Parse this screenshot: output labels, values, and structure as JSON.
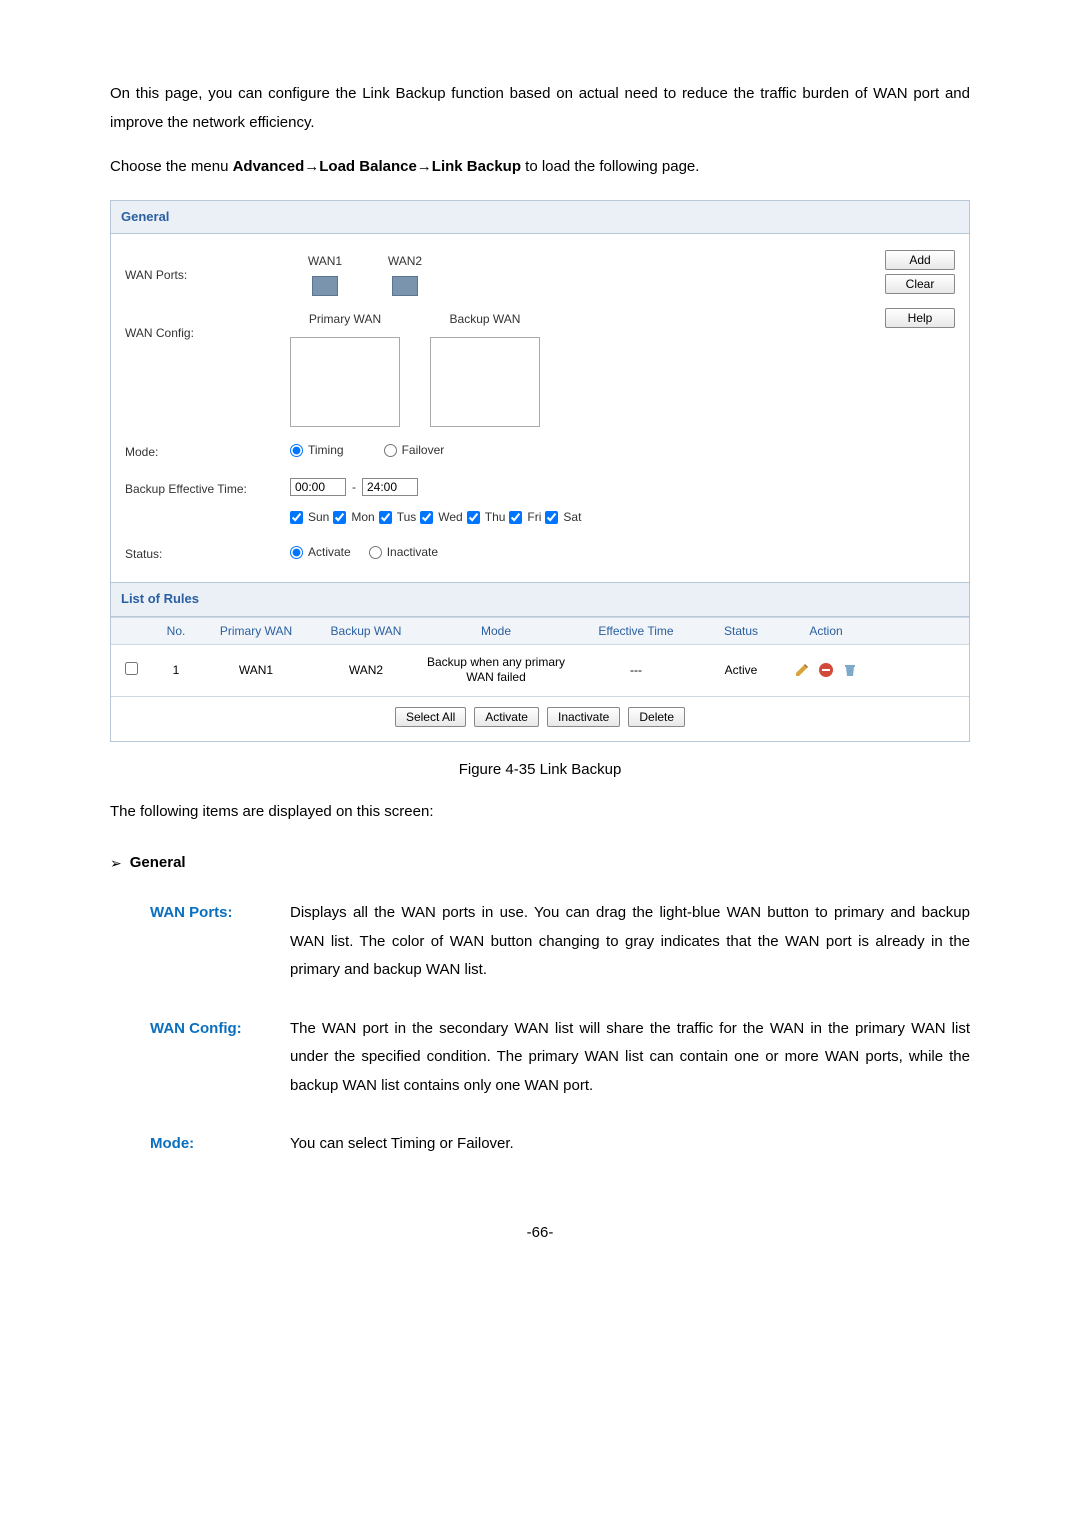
{
  "intro": "On this page, you can configure the Link Backup function based on actual need to reduce the traffic burden of WAN port and improve the network efficiency.",
  "menu_prefix": "Choose the menu ",
  "menu_bold": "Advanced→Load Balance→Link Backup",
  "menu_suffix": " to load the following page.",
  "panel": {
    "general_title": "General",
    "wan_ports_label": "WAN Ports:",
    "wan1": "WAN1",
    "wan2": "WAN2",
    "add": "Add",
    "clear": "Clear",
    "help": "Help",
    "wan_config_label": "WAN Config:",
    "primary_wan": "Primary WAN",
    "backup_wan": "Backup WAN",
    "mode_label": "Mode:",
    "mode_timing": "Timing",
    "mode_failover": "Failover",
    "bet_label": "Backup Effective Time:",
    "time_from": "00:00",
    "time_to": "24:00",
    "dash": "-",
    "days": {
      "sun": "Sun",
      "mon": "Mon",
      "tus": "Tus",
      "wed": "Wed",
      "thu": "Thu",
      "fri": "Fri",
      "sat": "Sat"
    },
    "status_label": "Status:",
    "status_activate": "Activate",
    "status_inactivate": "Inactivate",
    "rules_title": "List of Rules",
    "cols": {
      "no": "No.",
      "pw": "Primary WAN",
      "bw": "Backup WAN",
      "mode": "Mode",
      "et": "Effective Time",
      "status": "Status",
      "action": "Action"
    },
    "row1": {
      "no": "1",
      "pw": "WAN1",
      "bw": "WAN2",
      "mode": "Backup when any primary WAN failed",
      "et": "---",
      "status": "Active"
    },
    "btns": {
      "selectall": "Select All",
      "activate": "Activate",
      "inactivate": "Inactivate",
      "delete": "Delete"
    }
  },
  "figcap": "Figure 4-35 Link Backup",
  "lead": "The following items are displayed on this screen:",
  "general_bullet": "General",
  "defs": {
    "wan_ports": {
      "label": "WAN Ports:",
      "text": "Displays all the WAN ports in use. You can drag the light-blue WAN button to primary and backup WAN list. The color of WAN button changing to gray indicates that the WAN port is already in the primary and backup WAN list."
    },
    "wan_config": {
      "label": "WAN Config:",
      "text": "The WAN port in the secondary WAN list will share the traffic for the WAN in the primary WAN list under the specified condition. The primary WAN list can contain one or more WAN ports, while the backup WAN list contains only one WAN port."
    },
    "mode": {
      "label": "Mode:",
      "text": "You can select Timing or Failover."
    }
  },
  "pagenum": "-66-"
}
